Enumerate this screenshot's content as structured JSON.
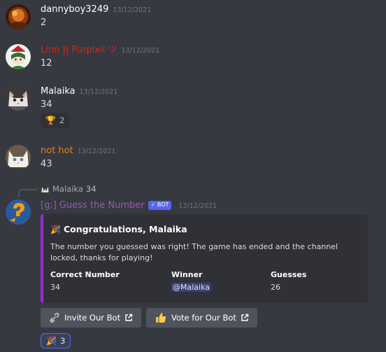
{
  "messages": [
    {
      "username": "dannyboy3249",
      "timestamp": "13/12/2021",
      "content": "2",
      "name_color": "#ffffff"
    },
    {
      "username": "Linn || Purplxii ツ",
      "timestamp": "13/12/2021",
      "content": "12",
      "name_color": "#e91e1e"
    },
    {
      "username": "Malaika",
      "timestamp": "13/12/2021",
      "content": "34",
      "name_color": "#ffffff"
    },
    {
      "username": "not hot",
      "timestamp": "13/12/2021",
      "content": "43",
      "name_color": "#e67e22"
    }
  ],
  "reaction_trophy": {
    "emoji": "🏆",
    "count": "2"
  },
  "reply": {
    "username": "Malaika",
    "content": "34"
  },
  "bot_message": {
    "username": "[g;] Guess the Number",
    "name_color": "#9b59b6",
    "bot_tag": "✓ BOT",
    "timestamp": "13/12/2021",
    "embed": {
      "title_emoji": "🎉",
      "title": "Congratulations, Malaika",
      "description": "The number you guessed was right! The game has ended and the channel locked, thanks for playing!",
      "accent_color": "#9b2bd6",
      "fields": [
        {
          "name": "Correct Number",
          "value": "34"
        },
        {
          "name": "Winner",
          "value": "@Malaika"
        },
        {
          "name": "Guesses",
          "value": "26"
        }
      ]
    },
    "buttons": [
      {
        "label": "Invite Our Bot",
        "icon": "link-icon"
      },
      {
        "label": "Vote for Our Bot",
        "icon": "thumbs-up-icon"
      }
    ],
    "reaction": {
      "emoji": "🎉",
      "count": "3"
    }
  }
}
